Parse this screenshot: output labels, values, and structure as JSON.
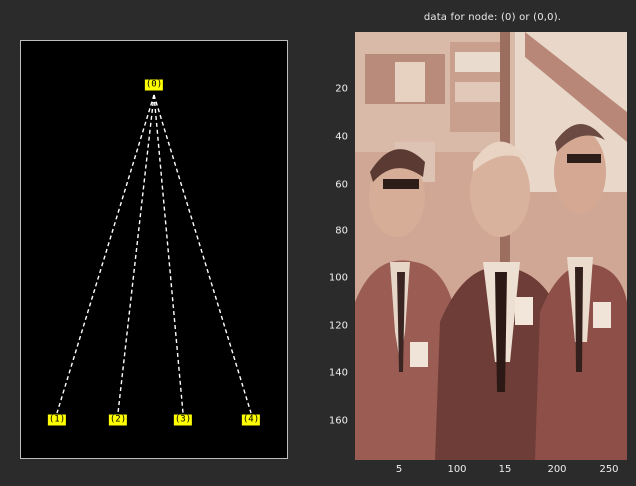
{
  "tree": {
    "root": {
      "label": "(0)"
    },
    "children": [
      {
        "label": "(1)"
      },
      {
        "label": "(2)"
      },
      {
        "label": "(3)"
      },
      {
        "label": "(4)"
      }
    ]
  },
  "image_view": {
    "title": "data for node: (0) or (0,0).",
    "y_ticks": [
      "20",
      "40",
      "60",
      "80",
      "100",
      "120",
      "140",
      "160"
    ],
    "x_ticks": [
      "5",
      "100",
      "15",
      "200",
      "250"
    ]
  },
  "colors": {
    "node_fill": "#ffff00",
    "edge": "#ffffff",
    "tree_bg": "#000000",
    "figure_bg": "#2b2b2b"
  }
}
